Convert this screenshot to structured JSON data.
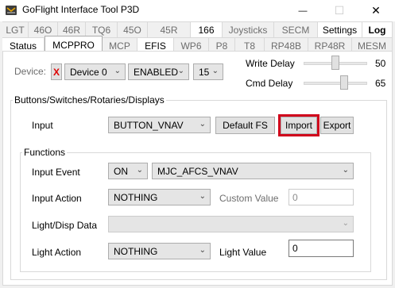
{
  "window": {
    "title": "GoFlight Interface Tool P3D",
    "minimize_glyph": "—",
    "maximize_glyph": "☐",
    "close_glyph": "✕"
  },
  "tabs_row1": [
    {
      "label": "LGT"
    },
    {
      "label": "46O"
    },
    {
      "label": "46R"
    },
    {
      "label": "TQ6"
    },
    {
      "label": "45O"
    },
    {
      "label": "45R"
    },
    {
      "label": "166"
    },
    {
      "label": "Joysticks"
    },
    {
      "label": "SECM"
    },
    {
      "label": "Settings"
    },
    {
      "label": "Log"
    }
  ],
  "tabs_row2": [
    {
      "label": "Status"
    },
    {
      "label": "MCPPRO"
    },
    {
      "label": "MCP"
    },
    {
      "label": "EFIS"
    },
    {
      "label": "WP6"
    },
    {
      "label": "P8"
    },
    {
      "label": "T8"
    },
    {
      "label": "RP48B"
    },
    {
      "label": "RP48R"
    },
    {
      "label": "MESM"
    }
  ],
  "device": {
    "label": "Device:",
    "remove_glyph": "X",
    "device_select": "Device 0",
    "state_select": "ENABLED",
    "number_select": "15"
  },
  "delays": {
    "write_label": "Write Delay",
    "write_value": "50",
    "write_fraction": 0.5,
    "cmd_label": "Cmd Delay",
    "cmd_value": "65",
    "cmd_fraction": 0.65
  },
  "buttons_group": {
    "title": "Buttons/Switches/Rotaries/Displays",
    "input_label": "Input",
    "input_select": "BUTTON_VNAV",
    "default_fs": "Default FS",
    "import": "Import",
    "export": "Export"
  },
  "functions_group": {
    "title": "Functions",
    "input_event_label": "Input Event",
    "event_state": "ON",
    "event_name": "MJC_AFCS_VNAV",
    "input_action_label": "Input Action",
    "input_action_select": "NOTHING",
    "custom_value_label": "Custom Value",
    "custom_value": "0",
    "light_disp_label": "Light/Disp Data",
    "light_disp_select": "",
    "light_action_label": "Light Action",
    "light_action_select": "NOTHING",
    "light_value_label": "Light Value",
    "light_value": "0"
  },
  "colors": {
    "accent": "#007acc",
    "highlight": "#d0021b"
  }
}
